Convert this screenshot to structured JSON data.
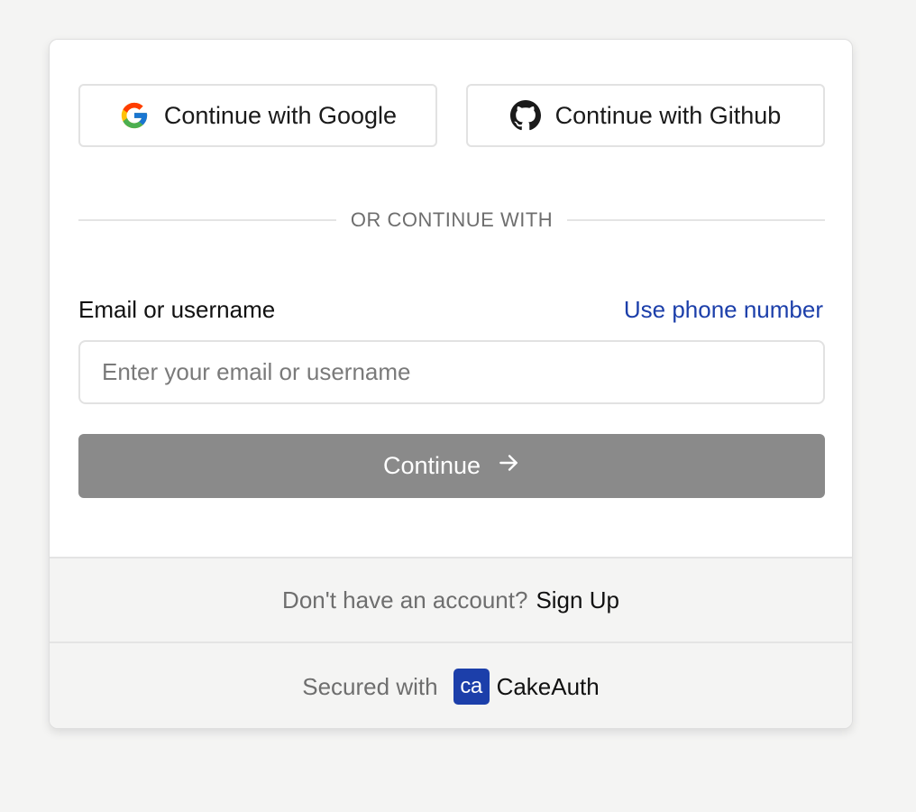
{
  "social": {
    "google_label": "Continue with Google",
    "github_label": "Continue with Github"
  },
  "divider": {
    "text": "OR CONTINUE WITH"
  },
  "form": {
    "email_label": "Email or username",
    "phone_link": "Use phone number",
    "email_placeholder": "Enter your email or username",
    "email_value": "",
    "continue_label": "Continue"
  },
  "signup": {
    "prompt": "Don't have an account?",
    "link": "Sign Up"
  },
  "footer": {
    "secured_text": "Secured with",
    "logo_text": "ca",
    "brand_name": "CakeAuth"
  },
  "colors": {
    "brand": "#1c3faa",
    "continue_disabled": "#8a8a8a",
    "page_background": "#f4f4f3"
  },
  "icons": [
    "google-icon",
    "github-icon",
    "arrow-right-icon",
    "cakeauth-logo"
  ]
}
